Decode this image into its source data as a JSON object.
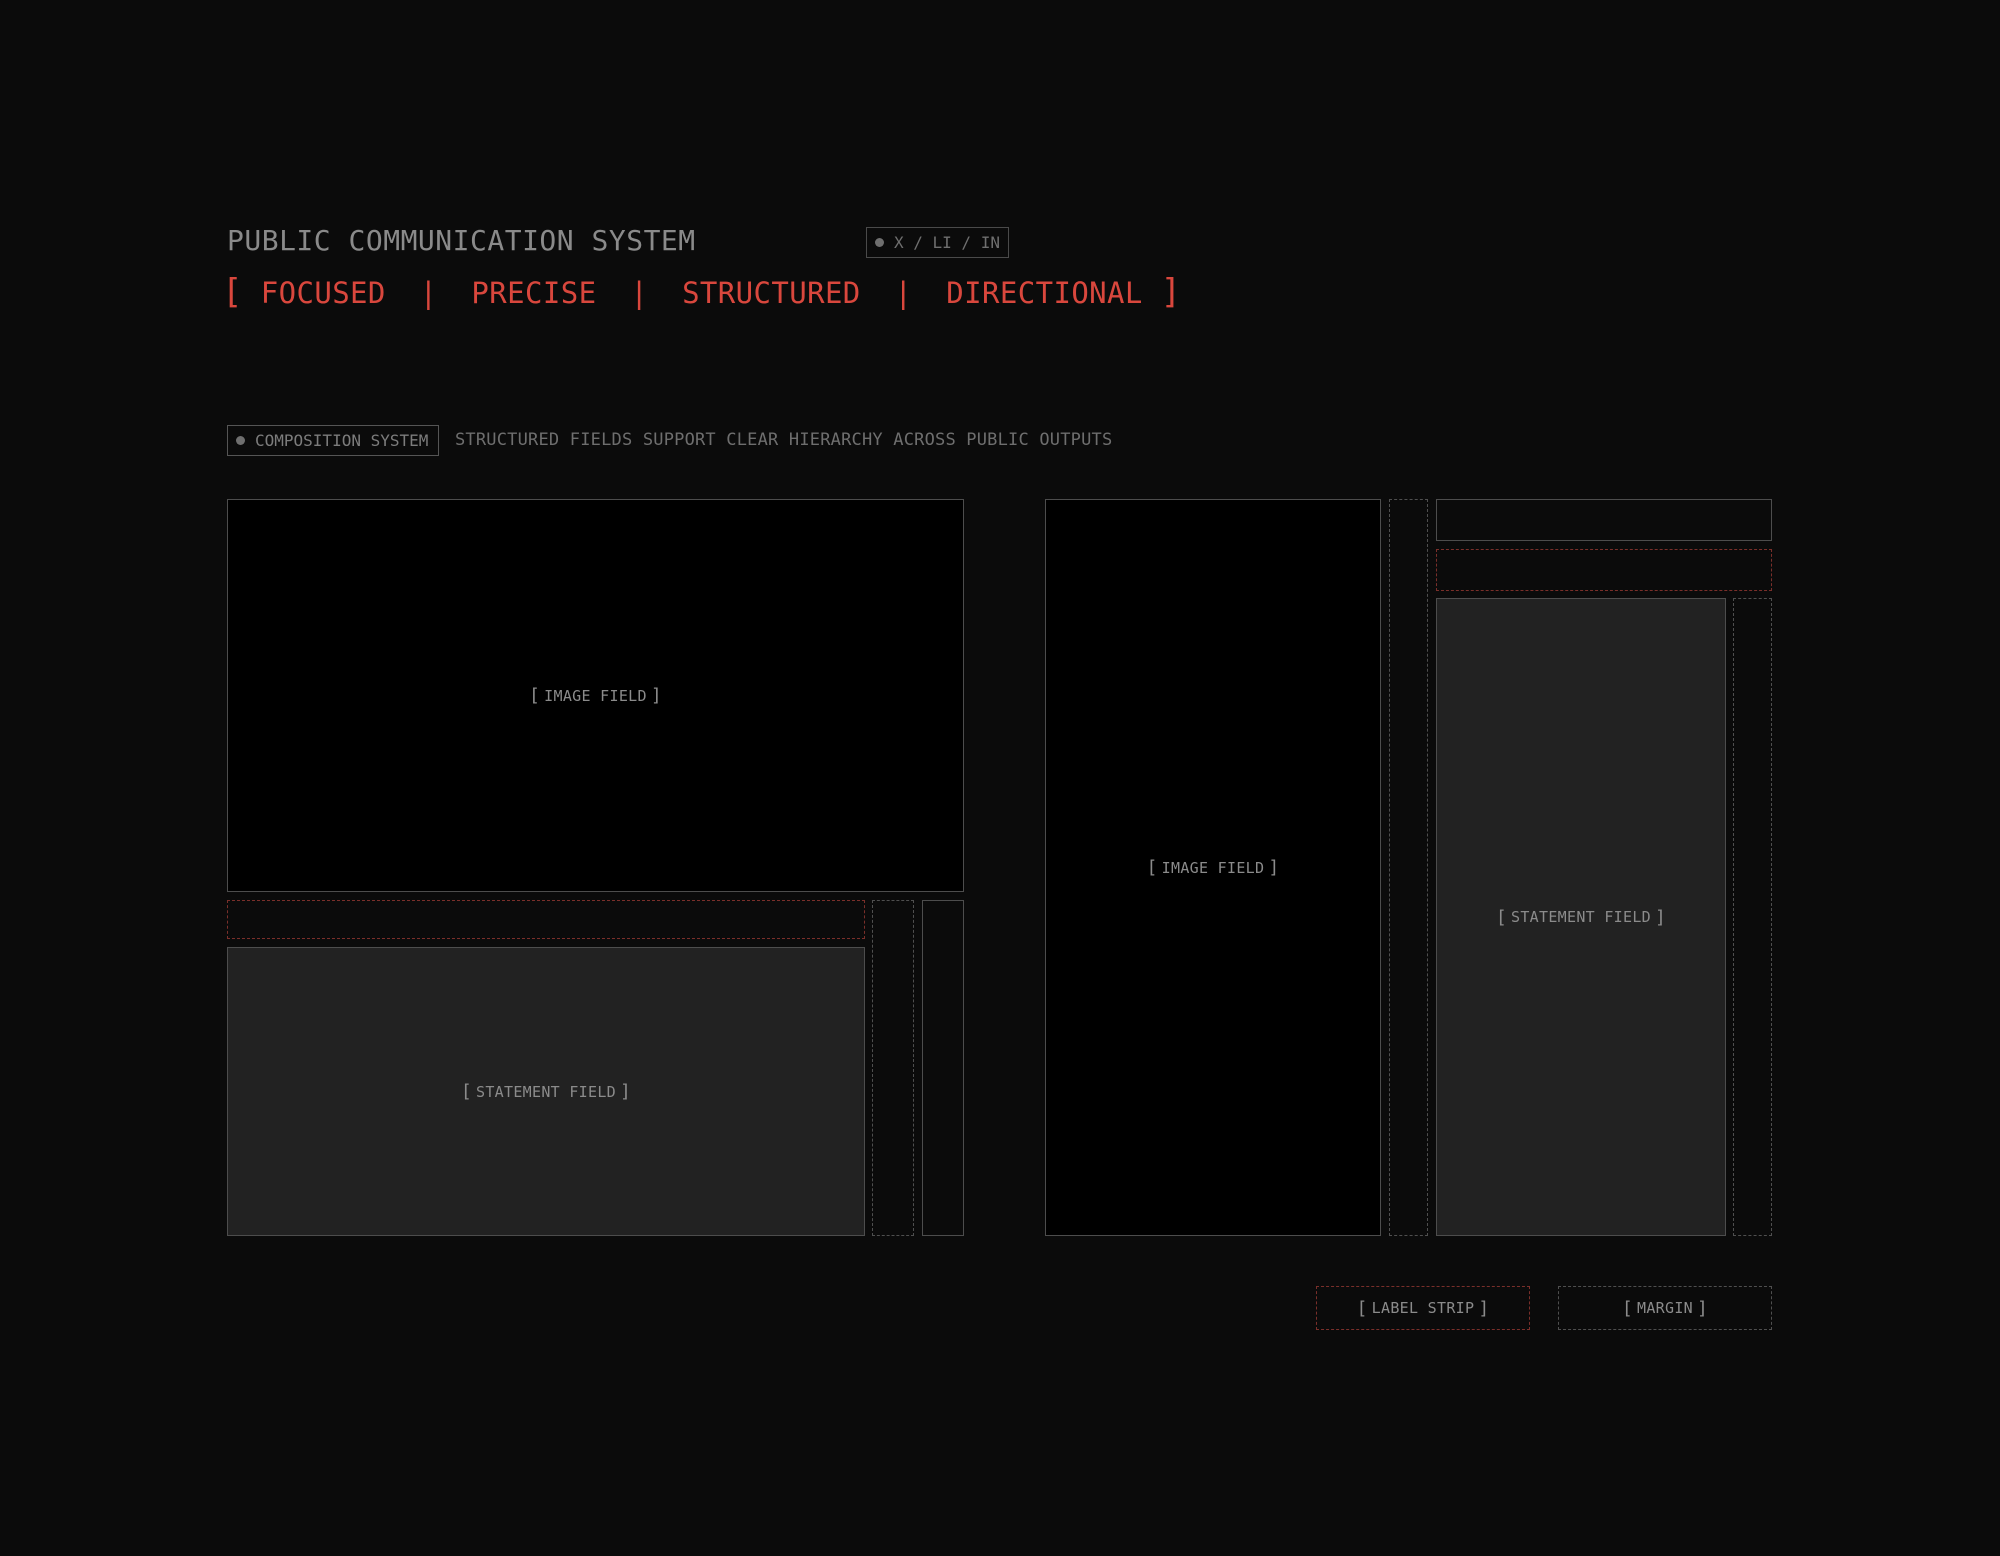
{
  "header": {
    "title": "PUBLIC COMMUNICATION SYSTEM",
    "channels": "X / LI / IN",
    "tagline": {
      "open": "[",
      "items": [
        "FOCUSED",
        "PRECISE",
        "STRUCTURED",
        "DIRECTIONAL"
      ],
      "separator": "|",
      "close": "]"
    }
  },
  "section": {
    "badge": "COMPOSITION SYSTEM",
    "description": "STRUCTURED FIELDS SUPPORT CLEAR HIERARCHY ACROSS PUBLIC OUTPUTS"
  },
  "fields": {
    "image": "IMAGE FIELD",
    "statement": "STATEMENT FIELD"
  },
  "legend": {
    "label_strip": "LABEL STRIP",
    "margin": "MARGIN"
  },
  "colors": {
    "background": "#0b0b0b",
    "accent": "#d9473d",
    "image_fill": "#000000",
    "statement_fill": "#222222"
  }
}
